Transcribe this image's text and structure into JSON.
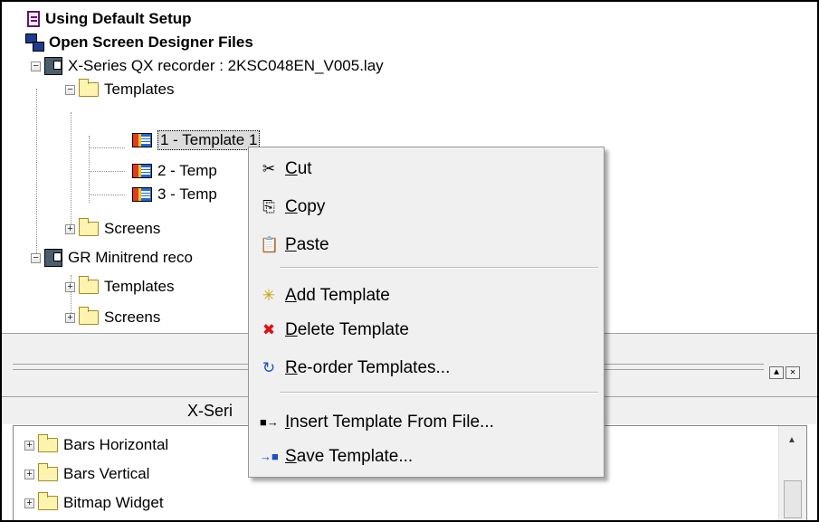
{
  "tree": {
    "header1": "Using Default Setup",
    "header2": "Open Screen Designer Files",
    "nodes": [
      {
        "label": "X-Series QX recorder : 2KSC048EN_V005.lay",
        "expander": "−"
      },
      {
        "label": "Templates",
        "expander": "−"
      },
      {
        "label": "1 - Template 1"
      },
      {
        "label": "2 - Temp"
      },
      {
        "label": "3 - Temp"
      },
      {
        "label": "Screens",
        "expander": "+"
      },
      {
        "label": "GR Minitrend reco",
        "expander": "−"
      },
      {
        "label": "Templates",
        "expander": "+"
      },
      {
        "label": "Screens",
        "expander": "+"
      }
    ]
  },
  "panel2": {
    "title": "X-Seri",
    "min_btn": "▲",
    "close_btn": "✕",
    "items": [
      {
        "label": "Bars Horizontal",
        "expander": "+"
      },
      {
        "label": "Bars Vertical",
        "expander": "+"
      },
      {
        "label": "Bitmap Widget",
        "expander": "+"
      }
    ],
    "scroll_up": "▲"
  },
  "context_menu": {
    "items": [
      {
        "key": "C",
        "rest": "ut",
        "icon": "scissors-icon",
        "glyph": "✂"
      },
      {
        "key": "C",
        "rest": "opy",
        "icon": "copy-icon",
        "glyph": "⎘"
      },
      {
        "key": "P",
        "rest": "aste",
        "icon": "clipboard-icon",
        "glyph": "📋"
      },
      {
        "key": "A",
        "rest": "dd Template",
        "icon": "add-template-icon",
        "glyph": "✳"
      },
      {
        "key": "D",
        "rest": "elete Template",
        "icon": "delete-template-icon",
        "glyph": "✖"
      },
      {
        "key": "R",
        "rest": "e-order Templates...",
        "icon": "reorder-icon",
        "glyph": "↻"
      },
      {
        "key": "I",
        "rest": "nsert Template From File...",
        "icon": "insert-file-icon",
        "glyph": "■→"
      },
      {
        "key": "S",
        "rest": "ave Template...",
        "icon": "save-file-icon",
        "glyph": "→■"
      }
    ]
  }
}
